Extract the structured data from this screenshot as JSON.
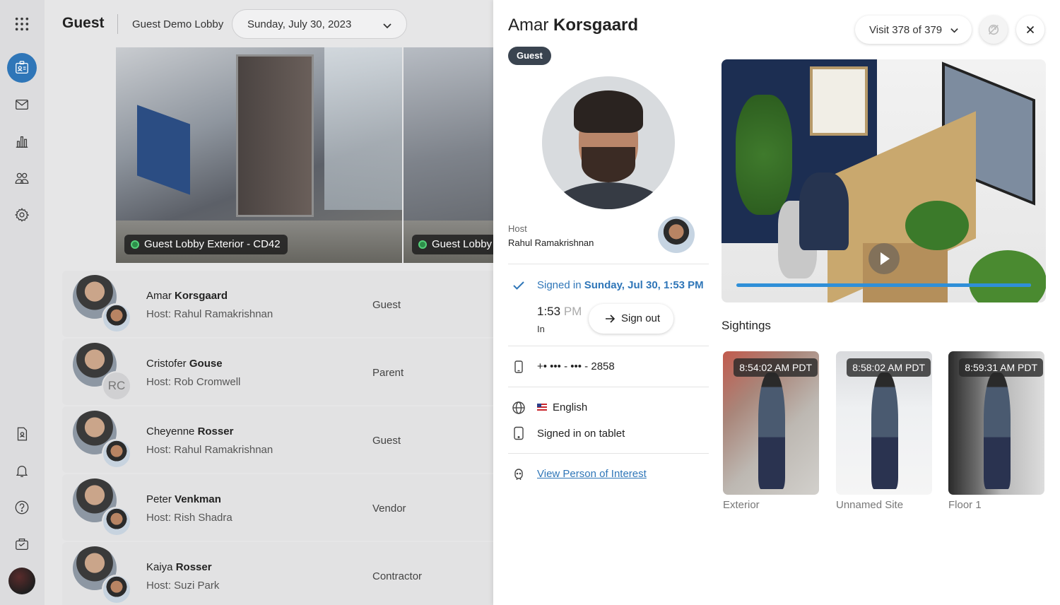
{
  "nav": {
    "apps_icon": "grid-icon",
    "items": [
      {
        "name": "visitors-nav",
        "icon": "id-badge-icon",
        "active": true
      },
      {
        "name": "mail-nav",
        "icon": "mail-icon"
      },
      {
        "name": "analytics-nav",
        "icon": "bar-chart-icon"
      },
      {
        "name": "people-nav",
        "icon": "people-icon"
      },
      {
        "name": "settings-nav",
        "icon": "gear-icon"
      },
      {
        "name": "badge-nav",
        "icon": "document-badge-icon"
      },
      {
        "name": "notifications-nav",
        "icon": "bell-icon"
      },
      {
        "name": "help-nav",
        "icon": "question-icon"
      },
      {
        "name": "kiosk-nav",
        "icon": "kiosk-icon"
      }
    ]
  },
  "header": {
    "title": "Guest",
    "location": "Guest Demo Lobby",
    "date": "Sunday, July 30, 2023"
  },
  "cameras": [
    {
      "label": "Guest Lobby Exterior - CD42"
    },
    {
      "label": "Guest Lobby"
    }
  ],
  "visits": [
    {
      "first": "Amar",
      "last": "Korsgaard",
      "host": "Host: Rahul Ramakrishnan",
      "type": "Guest",
      "host_initials": ""
    },
    {
      "first": "Cristofer",
      "last": "Gouse",
      "host": "Host: Rob Cromwell",
      "type": "Parent",
      "host_initials": "RC"
    },
    {
      "first": "Cheyenne",
      "last": "Rosser",
      "host": "Host: Rahul Ramakrishnan",
      "type": "Guest",
      "host_initials": ""
    },
    {
      "first": "Peter",
      "last": "Venkman",
      "host": "Host: Rish Shadra",
      "type": "Vendor",
      "host_initials": ""
    },
    {
      "first": "Kaiya",
      "last": "Rosser",
      "host": "Host: Suzi Park",
      "type": "Contractor",
      "host_initials": ""
    }
  ],
  "detail": {
    "first_name": "Amar",
    "last_name": "Korsgaard",
    "badge": "Guest",
    "visit_selector": "Visit 378 of 379",
    "host_label": "Host",
    "host_name": "Rahul Ramakrishnan",
    "signed_in_prefix": "Signed in",
    "signed_in_date": "Sunday, Jul 30, 1:53 PM",
    "time": "1:53",
    "time_ampm": "PM",
    "in_label": "In",
    "sign_out_label": "Sign out",
    "phone": "+• ••• - ••• - 2858",
    "language": "English",
    "signed_in_method": "Signed in on tablet",
    "poi_link": "View Person of Interest",
    "video_progress": 1.0,
    "sightings_title": "Sightings",
    "sightings": [
      {
        "time": "8:54:02 AM PDT",
        "site": "Exterior"
      },
      {
        "time": "8:58:02 AM PDT",
        "site": "Unnamed Site"
      },
      {
        "time": "8:59:31 AM PDT",
        "site": "Floor 1"
      }
    ]
  },
  "colors": {
    "accent": "#2f76b8",
    "badge_bg": "#3a4450",
    "progress": "#2f8fd8"
  }
}
